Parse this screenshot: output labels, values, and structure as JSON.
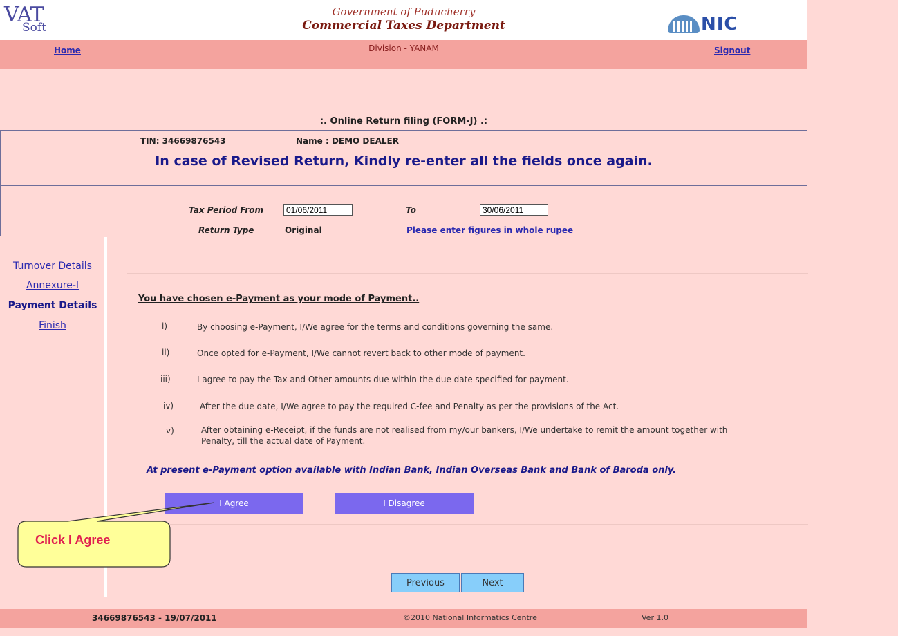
{
  "header": {
    "logo_main": "VAT",
    "logo_sub": "Soft",
    "gov_line1": "Government of Puducherry",
    "gov_line2": "Commercial Taxes Department",
    "nic_logo": "NIC"
  },
  "nav": {
    "home": "Home",
    "division": "Division - YANAM",
    "signout": "Signout"
  },
  "form_title": ":. Online Return filing (FORM-J) .:",
  "dealer": {
    "tin": "TIN:  34669876543",
    "name": "Name :  DEMO DEALER",
    "revised_notice": "In case of Revised Return, Kindly re-enter all the fields once again."
  },
  "period": {
    "from_label": "Tax Period From",
    "from_value": "01/06/2011",
    "to_label": "To",
    "to_value": "30/06/2011",
    "return_type_label": "Return Type",
    "return_type_value": "Original",
    "whole_rupee_note": "Please enter figures in whole rupee"
  },
  "sidebar": {
    "items": [
      {
        "label": "Turnover Details"
      },
      {
        "label": "Annexure-I"
      },
      {
        "label": "Payment Details"
      },
      {
        "label": "Finish"
      }
    ]
  },
  "epayment": {
    "heading": "You have chosen e-Payment as your mode of Payment..",
    "terms": [
      {
        "no": "i)",
        "text": "By choosing e-Payment, I/We agree for the terms and conditions governing the same."
      },
      {
        "no": "ii)",
        "text": "Once opted for e-Payment, I/We cannot revert back to other mode of payment."
      },
      {
        "no": "iii)",
        "text": "I agree to pay the Tax and Other amounts due within the due date specified for payment."
      },
      {
        "no": "iv)",
        "text": "After the due date, I/We agree to pay the required C-fee and Penalty as per the provisions of the Act."
      },
      {
        "no": "v)",
        "text": "After obtaining e-Receipt, if the funds are not realised from my/our bankers, I/We undertake to remit the amount together with Penalty, till the actual date of  Payment."
      }
    ],
    "banks_note": "At present e-Payment option available with Indian Bank, Indian Overseas Bank and Bank of Baroda only.",
    "agree_label": "I Agree",
    "disagree_label": "I Disagree"
  },
  "navigation": {
    "previous": "Previous",
    "next": "Next"
  },
  "callout": {
    "text": "Click I Agree"
  },
  "footer": {
    "tin_date": "34669876543 - 19/07/2011",
    "copyright": "©2010 National Informatics Centre",
    "version": "Ver 1.0"
  },
  "colors": {
    "page_bg": "#ffd9d6",
    "bar_bg": "#f4a39e",
    "button_purple": "#7b68ee",
    "button_blue": "#87cefa",
    "link_blue": "#2a2ab0",
    "callout_bg": "#ffff99",
    "callout_text": "#e02050"
  }
}
